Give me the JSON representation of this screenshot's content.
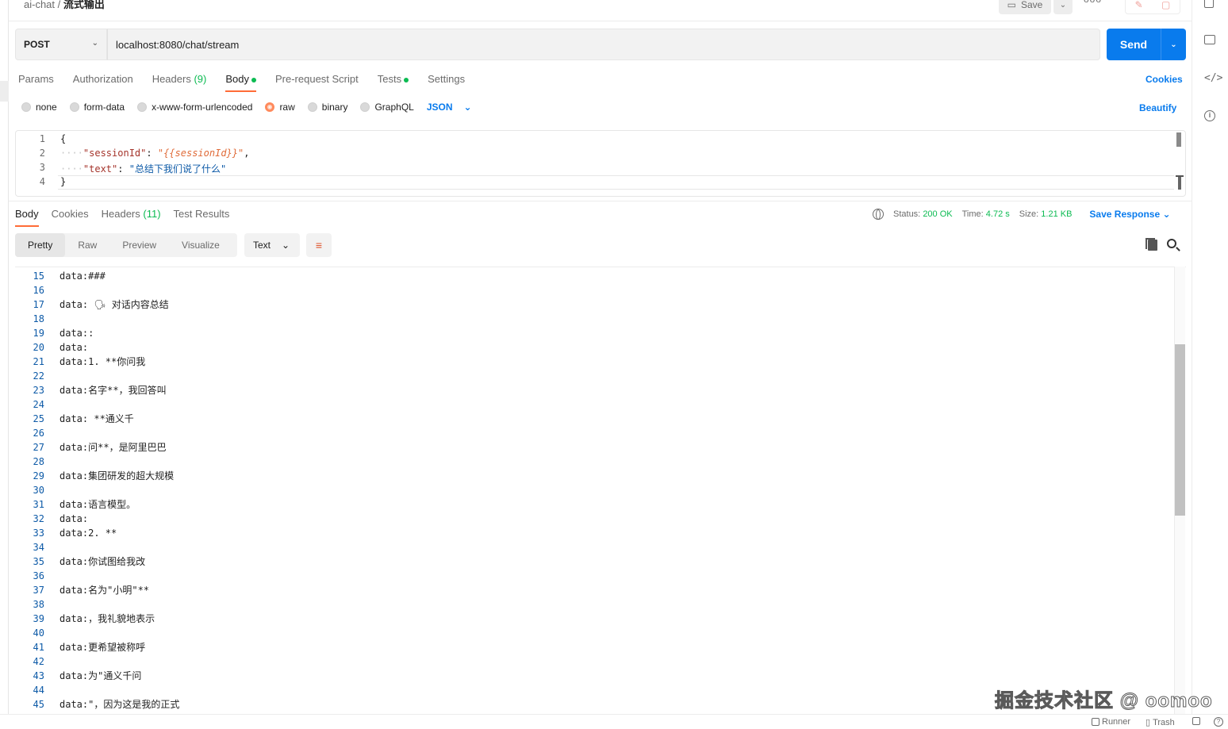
{
  "topbar": {
    "breadcrumb_parent": "ai-chat",
    "breadcrumb_sep": "/",
    "breadcrumb_current": "流式输出",
    "save_label": "Save",
    "more_label": "ooo"
  },
  "request": {
    "method": "POST",
    "url": "localhost:8080/chat/stream",
    "send_label": "Send"
  },
  "request_tabs": [
    {
      "label": "Params",
      "count": ""
    },
    {
      "label": "Authorization",
      "count": ""
    },
    {
      "label": "Headers",
      "count": "(9)"
    },
    {
      "label": "Body",
      "count": "",
      "active": true,
      "dot": true
    },
    {
      "label": "Pre-request Script",
      "count": ""
    },
    {
      "label": "Tests",
      "count": "",
      "dot": true
    },
    {
      "label": "Settings",
      "count": ""
    }
  ],
  "cookies_label": "Cookies",
  "body_types": [
    {
      "label": "none",
      "selected": false
    },
    {
      "label": "form-data",
      "selected": false
    },
    {
      "label": "x-www-form-urlencoded",
      "selected": false
    },
    {
      "label": "raw",
      "selected": true
    },
    {
      "label": "binary",
      "selected": false
    },
    {
      "label": "GraphQL",
      "selected": false
    }
  ],
  "body_format": "JSON",
  "beautify_label": "Beautify",
  "request_body": {
    "line_numbers": [
      "1",
      "2",
      "3",
      "4"
    ],
    "open_brace": "{",
    "close_brace": "}",
    "session_key": "\"sessionId\"",
    "session_val": "\"{{sessionId}}\"",
    "text_key": "\"text\"",
    "text_val": "\"总结下我们说了什么\""
  },
  "response_tabs": [
    {
      "label": "Body",
      "count": "",
      "active": true
    },
    {
      "label": "Cookies",
      "count": ""
    },
    {
      "label": "Headers",
      "count": "(11)"
    },
    {
      "label": "Test Results",
      "count": ""
    }
  ],
  "response_meta": {
    "status_label": "Status:",
    "status_value": "200 OK",
    "time_label": "Time:",
    "time_value": "4.72 s",
    "size_label": "Size:",
    "size_value": "1.21 KB",
    "save_response_label": "Save Response"
  },
  "view_modes": [
    "Pretty",
    "Raw",
    "Preview",
    "Visualize"
  ],
  "active_view": "Pretty",
  "text_format": "Text",
  "response_lines": [
    {
      "n": "15",
      "t": "data:###"
    },
    {
      "n": "16",
      "t": ""
    },
    {
      "n": "17",
      "t": "data: 🗣 对话内容总结"
    },
    {
      "n": "18",
      "t": ""
    },
    {
      "n": "19",
      "t": "data::"
    },
    {
      "n": "20",
      "t": "data:"
    },
    {
      "n": "21",
      "t": "data:1. **你问我"
    },
    {
      "n": "22",
      "t": ""
    },
    {
      "n": "23",
      "t": "data:名字**，我回答叫"
    },
    {
      "n": "24",
      "t": ""
    },
    {
      "n": "25",
      "t": "data: **通义千"
    },
    {
      "n": "26",
      "t": ""
    },
    {
      "n": "27",
      "t": "data:问**，是阿里巴巴"
    },
    {
      "n": "28",
      "t": ""
    },
    {
      "n": "29",
      "t": "data:集团研发的超大规模"
    },
    {
      "n": "30",
      "t": ""
    },
    {
      "n": "31",
      "t": "data:语言模型。"
    },
    {
      "n": "32",
      "t": "data:"
    },
    {
      "n": "33",
      "t": "data:2. **"
    },
    {
      "n": "34",
      "t": ""
    },
    {
      "n": "35",
      "t": "data:你试图给我改"
    },
    {
      "n": "36",
      "t": ""
    },
    {
      "n": "37",
      "t": "data:名为\"小明\"**"
    },
    {
      "n": "38",
      "t": ""
    },
    {
      "n": "39",
      "t": "data:，我礼貌地表示"
    },
    {
      "n": "40",
      "t": ""
    },
    {
      "n": "41",
      "t": "data:更希望被称呼"
    },
    {
      "n": "42",
      "t": ""
    },
    {
      "n": "43",
      "t": "data:为\"通义千问"
    },
    {
      "n": "44",
      "t": ""
    },
    {
      "n": "45",
      "t": "data:\"，因为这是我的正式"
    }
  ],
  "statusbar": {
    "runner_label": "Runner",
    "trash_label": "Trash"
  },
  "watermark": "掘金技术社区 @ oomoo"
}
